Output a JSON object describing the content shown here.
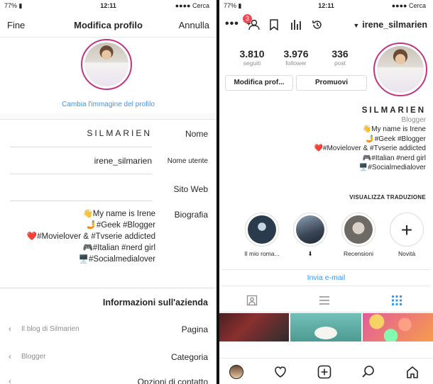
{
  "left": {
    "status": {
      "carrier": "Cerca",
      "time": "12:11",
      "battery": "77%"
    },
    "header": {
      "cancel": "Annulla",
      "title": "Modifica profilo",
      "done": "Fine"
    },
    "change_photo": "Cambia l'immagine del profilo",
    "fields": [
      {
        "label": "Nome",
        "value": "SILMARIEN"
      },
      {
        "label": "Nome utente",
        "value": "irene_silmarien"
      },
      {
        "label": "Sito Web",
        "value": ""
      },
      {
        "label": "Biografia",
        "value": "👋My name is Irene\n🤳#Geek #Blogger\n❤️#Movielover & #Tvserie addicted\n🎮#Italian #nerd girl\n🖥️#Socialmedialover"
      }
    ],
    "business": {
      "title": "Informazioni sull'azienda",
      "rows": [
        {
          "label": "Pagina",
          "value": "Il blog di Silmarien"
        },
        {
          "label": "Categoria",
          "value": "Blogger"
        },
        {
          "label": "Opzioni di contatto",
          "value": ""
        }
      ]
    }
  },
  "right": {
    "status": {
      "carrier": "Cerca",
      "time": "12:11",
      "battery": "77%"
    },
    "header": {
      "username": "irene_silmarien",
      "notifications": "3"
    },
    "stats": [
      {
        "number": "336",
        "label": "post"
      },
      {
        "number": "3.976",
        "label": "follower"
      },
      {
        "number": "3.810",
        "label": "seguiti"
      }
    ],
    "buttons": {
      "promote": "Promuovi",
      "edit": "Modifica prof..."
    },
    "name": "SILMARIEN",
    "category": "Blogger",
    "bio": "👋My name is Irene\n🤳#Geek #Blogger\n❤️#Movielover & #Tvserie addicted\n🎮#Italian #nerd girl\n🖥️#Socialmedialover",
    "see_translation": "VISUALIZZA TRADUZIONE",
    "highlights": [
      {
        "label": "Novità",
        "color": "#ffffff"
      },
      {
        "label": "Recensioni",
        "color": "#6d6a66"
      },
      {
        "label": "",
        "color": "#3a4654"
      },
      {
        "label": "Il mio roma...",
        "color": "#2a3b4e"
      }
    ],
    "email_button": "Invia e-mail",
    "grid_colors": [
      "#e25c9a",
      "#5fa8a0",
      "#6b2a2a"
    ],
    "accent": "#3897f0"
  }
}
